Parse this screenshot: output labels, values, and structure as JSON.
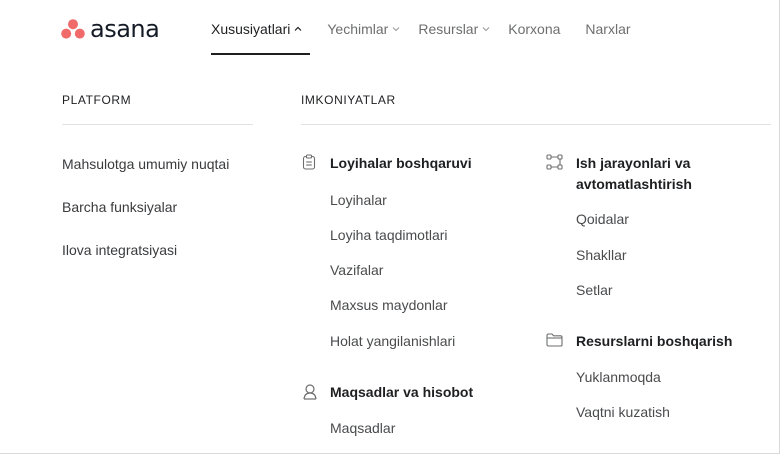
{
  "brand": {
    "name": "asana",
    "dot_color": "#f06a6a"
  },
  "nav": {
    "items": [
      {
        "label": "Xususiyatlari",
        "active": true,
        "chevron": "chevron-up"
      },
      {
        "label": "Yechimlar",
        "chevron": "chevron-down"
      },
      {
        "label": "Resurslar",
        "chevron": "chevron-down"
      },
      {
        "label": "Korxona"
      },
      {
        "label": "Narxlar"
      }
    ]
  },
  "platform": {
    "heading": "PLATFORM",
    "links": [
      "Mahsulotga umumiy nuqtai",
      "Barcha funksiyalar",
      "Ilova integratsiyasi"
    ]
  },
  "capabilities": {
    "heading": "IMKONIYATLAR",
    "groups": [
      {
        "title": "Loyihalar boshqaruvi",
        "icon": "clipboard-icon",
        "items": [
          "Loyihalar",
          "Loyiha taqdimotlari",
          "Vazifalar",
          "Maxsus maydonlar",
          "Holat yangilanishlari"
        ]
      },
      {
        "title": "Maqsadlar va hisobot",
        "icon": "goal-person-icon",
        "items": [
          "Maqsadlar"
        ]
      },
      {
        "title_line1": "Ish jarayonlari va",
        "title_line2": "avtomatlashtirish",
        "icon": "workflow-icon",
        "items": [
          "Qoidalar",
          "Shakllar",
          "Setlar"
        ]
      },
      {
        "title": "Resurslarni boshqarish",
        "icon": "folder-icon",
        "items": [
          "Yuklanmoqda",
          "Vaqtni kuzatish"
        ]
      }
    ]
  }
}
